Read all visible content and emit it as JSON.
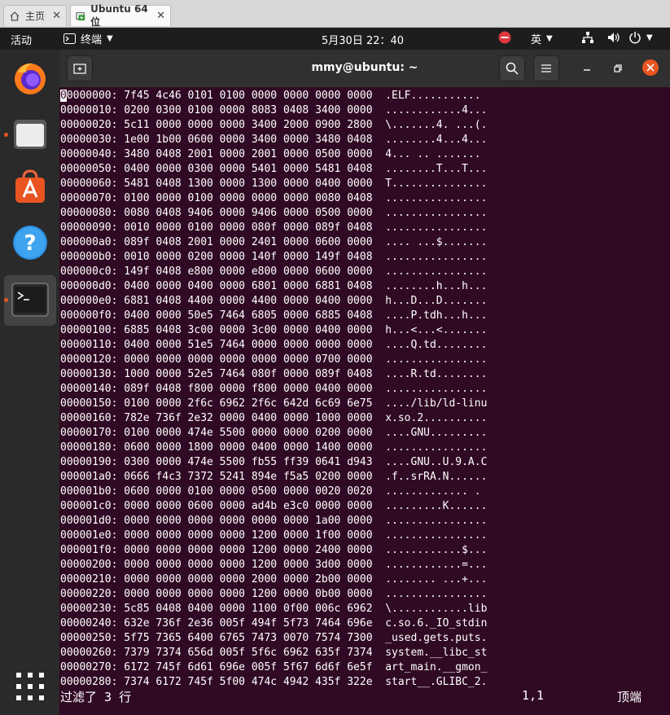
{
  "vm_tabs": [
    {
      "label": "主页",
      "icon": "home-icon"
    },
    {
      "label": "Ubuntu 64 位",
      "icon": "vm-icon"
    }
  ],
  "topbar": {
    "activities": "活动",
    "app_menu": "终端",
    "datetime": "5月30日  22：40",
    "input_method": "英"
  },
  "dock": [
    "firefox-icon",
    "files-icon",
    "software-icon",
    "help-icon",
    "terminal-icon"
  ],
  "window": {
    "title": "mmy@ubuntu: ~"
  },
  "colors": {
    "accent": "#e95420",
    "terminal_bg": "#300a24",
    "close": "#e95420"
  },
  "hexdump": [
    {
      "addr": "00000000:",
      "hex": "7f45 4c46 0101 0100 0000 0000 0000 0000",
      "ascii": ".ELF..........."
    },
    {
      "addr": "00000010:",
      "hex": "0200 0300 0100 0000 8083 0408 3400 0000",
      "ascii": "............4..."
    },
    {
      "addr": "00000020:",
      "hex": "5c11 0000 0000 0000 3400 2000 0900 2800",
      "ascii": "\\.......4. ...(."
    },
    {
      "addr": "00000030:",
      "hex": "1e00 1b00 0600 0000 3400 0000 3480 0408",
      "ascii": "........4...4..."
    },
    {
      "addr": "00000040:",
      "hex": "3480 0408 2001 0000 2001 0000 0500 0000",
      "ascii": "4... .. ......."
    },
    {
      "addr": "00000050:",
      "hex": "0400 0000 0300 0000 5401 0000 5481 0408",
      "ascii": "........T...T..."
    },
    {
      "addr": "00000060:",
      "hex": "5481 0408 1300 0000 1300 0000 0400 0000",
      "ascii": "T..............."
    },
    {
      "addr": "00000070:",
      "hex": "0100 0000 0100 0000 0000 0000 0080 0408",
      "ascii": "................"
    },
    {
      "addr": "00000080:",
      "hex": "0080 0408 9406 0000 9406 0000 0500 0000",
      "ascii": "................"
    },
    {
      "addr": "00000090:",
      "hex": "0010 0000 0100 0000 080f 0000 089f 0408",
      "ascii": "................"
    },
    {
      "addr": "000000a0:",
      "hex": "089f 0408 2001 0000 2401 0000 0600 0000",
      "ascii": ".... ...$......."
    },
    {
      "addr": "000000b0:",
      "hex": "0010 0000 0200 0000 140f 0000 149f 0408",
      "ascii": "................"
    },
    {
      "addr": "000000c0:",
      "hex": "149f 0408 e800 0000 e800 0000 0600 0000",
      "ascii": "................"
    },
    {
      "addr": "000000d0:",
      "hex": "0400 0000 0400 0000 6801 0000 6881 0408",
      "ascii": "........h...h..."
    },
    {
      "addr": "000000e0:",
      "hex": "6881 0408 4400 0000 4400 0000 0400 0000",
      "ascii": "h...D...D......."
    },
    {
      "addr": "000000f0:",
      "hex": "0400 0000 50e5 7464 6805 0000 6885 0408",
      "ascii": "....P.tdh...h..."
    },
    {
      "addr": "00000100:",
      "hex": "6885 0408 3c00 0000 3c00 0000 0400 0000",
      "ascii": "h...<...<......."
    },
    {
      "addr": "00000110:",
      "hex": "0400 0000 51e5 7464 0000 0000 0000 0000",
      "ascii": "....Q.td........"
    },
    {
      "addr": "00000120:",
      "hex": "0000 0000 0000 0000 0000 0000 0700 0000",
      "ascii": "................"
    },
    {
      "addr": "00000130:",
      "hex": "1000 0000 52e5 7464 080f 0000 089f 0408",
      "ascii": "....R.td........"
    },
    {
      "addr": "00000140:",
      "hex": "089f 0408 f800 0000 f800 0000 0400 0000",
      "ascii": "................"
    },
    {
      "addr": "00000150:",
      "hex": "0100 0000 2f6c 6962 2f6c 642d 6c69 6e75",
      "ascii": "..../lib/ld-linu"
    },
    {
      "addr": "00000160:",
      "hex": "782e 736f 2e32 0000 0400 0000 1000 0000",
      "ascii": "x.so.2.........."
    },
    {
      "addr": "00000170:",
      "hex": "0100 0000 474e 5500 0000 0000 0200 0000",
      "ascii": "....GNU........."
    },
    {
      "addr": "00000180:",
      "hex": "0600 0000 1800 0000 0400 0000 1400 0000",
      "ascii": "................"
    },
    {
      "addr": "00000190:",
      "hex": "0300 0000 474e 5500 fb55 ff39 0641 d943",
      "ascii": "....GNU..U.9.A.C"
    },
    {
      "addr": "000001a0:",
      "hex": "0666 f4c3 7372 5241 894e f5a5 0200 0000",
      "ascii": ".f..srRA.N......"
    },
    {
      "addr": "000001b0:",
      "hex": "0600 0000 0100 0000 0500 0000 0020 0020",
      "ascii": "............. ."
    },
    {
      "addr": "000001c0:",
      "hex": "0000 0000 0600 0000 ad4b e3c0 0000 0000",
      "ascii": ".........K......"
    },
    {
      "addr": "000001d0:",
      "hex": "0000 0000 0000 0000 0000 0000 1a00 0000",
      "ascii": "................"
    },
    {
      "addr": "000001e0:",
      "hex": "0000 0000 0000 0000 1200 0000 1f00 0000",
      "ascii": "................"
    },
    {
      "addr": "000001f0:",
      "hex": "0000 0000 0000 0000 1200 0000 2400 0000",
      "ascii": "............$..."
    },
    {
      "addr": "00000200:",
      "hex": "0000 0000 0000 0000 1200 0000 3d00 0000",
      "ascii": "............=..."
    },
    {
      "addr": "00000210:",
      "hex": "0000 0000 0000 0000 2000 0000 2b00 0000",
      "ascii": "........ ...+..."
    },
    {
      "addr": "00000220:",
      "hex": "0000 0000 0000 0000 1200 0000 0b00 0000",
      "ascii": "................"
    },
    {
      "addr": "00000230:",
      "hex": "5c85 0408 0400 0000 1100 0f00 006c 6962",
      "ascii": "\\............lib"
    },
    {
      "addr": "00000240:",
      "hex": "632e 736f 2e36 005f 494f 5f73 7464 696e",
      "ascii": "c.so.6._IO_stdin"
    },
    {
      "addr": "00000250:",
      "hex": "5f75 7365 6400 6765 7473 0070 7574 7300",
      "ascii": "_used.gets.puts."
    },
    {
      "addr": "00000260:",
      "hex": "7379 7374 656d 005f 5f6c 6962 635f 7374",
      "ascii": "system.__libc_st"
    },
    {
      "addr": "00000270:",
      "hex": "6172 745f 6d61 696e 005f 5f67 6d6f 6e5f",
      "ascii": "art_main.__gmon_"
    },
    {
      "addr": "00000280:",
      "hex": "7374 6172 745f 5f00 474c 4942 435f 322e",
      "ascii": "start__.GLIBC_2."
    }
  ],
  "status_line": {
    "message": "过滤了 3 行",
    "position": "1,1",
    "scroll": "顶端"
  }
}
